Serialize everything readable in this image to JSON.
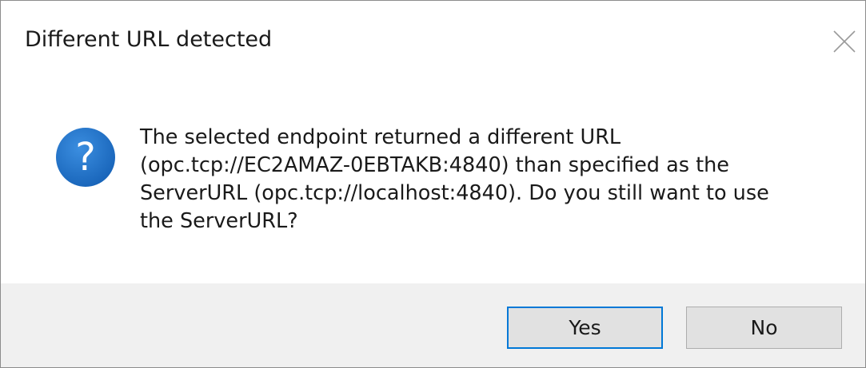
{
  "dialog": {
    "title": "Different URL detected",
    "icon": "question-icon",
    "message_lines": [
      "The selected endpoint returned a different URL",
      "(opc.tcp://EC2AMAZ-0EBTAKB:4840) than specified as the",
      "ServerURL (opc.tcp://localhost:4840). Do you still want to use",
      "the ServerURL?"
    ],
    "buttons": {
      "yes_label": "Yes",
      "no_label": "No"
    }
  },
  "colors": {
    "accent": "#0078d7",
    "icon_blue": "#1a6fc4",
    "footer_bg": "#f0f0f0",
    "button_bg": "#e1e1e1"
  }
}
